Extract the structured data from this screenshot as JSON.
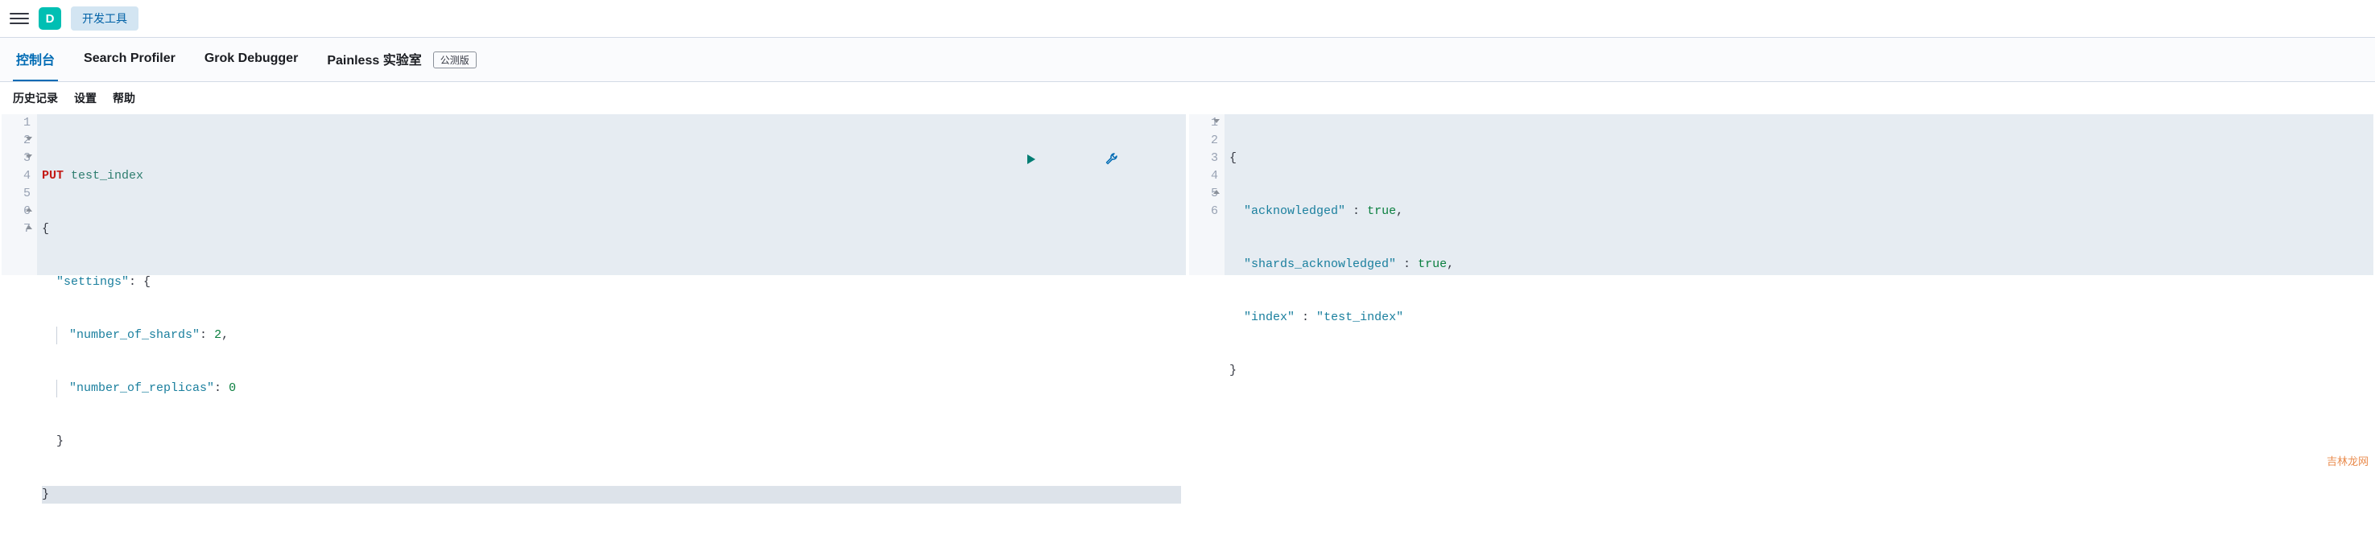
{
  "header": {
    "logo_letter": "D",
    "devtools_label": "开发工具"
  },
  "tabs": {
    "console": "控制台",
    "search_profiler": "Search Profiler",
    "grok_debugger": "Grok Debugger",
    "painless_lab": "Painless 实验室",
    "beta_badge": "公测版"
  },
  "subnav": {
    "history": "历史记录",
    "settings": "设置",
    "help": "帮助"
  },
  "request_editor": {
    "method": "PUT",
    "path": "test_index",
    "body": {
      "settings": {
        "number_of_shards": 2,
        "number_of_replicas": 0
      }
    },
    "lines": [
      {
        "n": "1",
        "fold": null
      },
      {
        "n": "2",
        "fold": "down"
      },
      {
        "n": "3",
        "fold": "down"
      },
      {
        "n": "4",
        "fold": null
      },
      {
        "n": "5",
        "fold": null
      },
      {
        "n": "6",
        "fold": "up"
      },
      {
        "n": "7",
        "fold": "up"
      }
    ]
  },
  "response_editor": {
    "body": {
      "acknowledged": true,
      "shards_acknowledged": true,
      "index": "test_index"
    },
    "lines": [
      {
        "n": "1",
        "fold": "down"
      },
      {
        "n": "2",
        "fold": null
      },
      {
        "n": "3",
        "fold": null
      },
      {
        "n": "4",
        "fold": null
      },
      {
        "n": "5",
        "fold": "up"
      },
      {
        "n": "6",
        "fold": null
      }
    ]
  },
  "watermark": "吉林龙网"
}
